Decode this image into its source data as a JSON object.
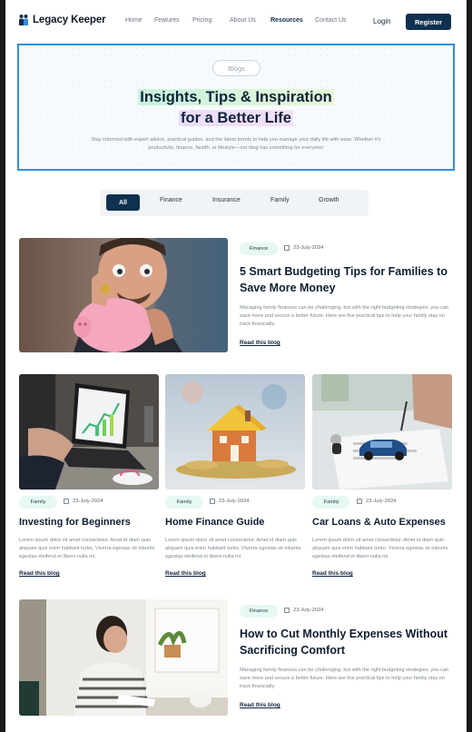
{
  "brand": {
    "name": "Legacy Keeper"
  },
  "nav": {
    "items": [
      "Home",
      "Features",
      "Pricing",
      "About Us",
      "Resources",
      "Contact Us"
    ],
    "active": "Resources",
    "login": "Login",
    "register": "Register"
  },
  "hero": {
    "pill": "Blogs",
    "title_line1": "Insights, Tips & Inspiration",
    "title_line2": "for a Better Life",
    "subtitle": "Stay informed with expert advice, practical guides, and the latest trends to help you manage your daily life with ease. Whether it's productivity, finance, health, or lifestyle—our blog has something for everyone!"
  },
  "filters": {
    "tabs": [
      "All",
      "Finance",
      "Insurance",
      "Family",
      "Growth"
    ],
    "active": "All"
  },
  "posts": [
    {
      "category": "Finance",
      "date": "23-July-2024",
      "title": "5 Smart Budgeting Tips for Families to Save More Money",
      "excerpt": "Managing family finances can be challenging, but with the right budgeting strategies, you can save more and secure a better future. Here are five practical tips to help your family stay on track financially.",
      "read_more": "Read this blog",
      "image": "piggy-bank-man"
    },
    {
      "category": "Family",
      "date": "23-July-2024",
      "title": "Investing for Beginners",
      "excerpt": "Lorem ipsum dolor sit amet consectetur. Amet id diam quis aliquam quis enim habitant tortor. Viverra egestas sit lobortis egestas eleifend et libero nulla mi.",
      "read_more": "Read this blog",
      "image": "laptop-charts"
    },
    {
      "category": "Family",
      "date": "23-July-2024",
      "title": "Home Finance Guide",
      "excerpt": "Lorem ipsum dolor sit amet consectetur. Amet id diam quis aliquam quis enim habitant tortor. Viverra egestas sit lobortis egestas eleifend et libero nulla mi.",
      "read_more": "Read this blog",
      "image": "house-on-coins"
    },
    {
      "category": "Family",
      "date": "23-July-2024",
      "title": "Car Loans & Auto Expenses",
      "excerpt": "Lorem ipsum dolor sit amet consectetur. Amet id diam quis aliquam quis enim habitant tortor. Viverra egestas sit lobortis egestas eleifend et libero nulla mi.",
      "read_more": "Read this blog",
      "image": "car-keys-signing"
    },
    {
      "category": "Finance",
      "date": "23-July-2024",
      "title": "How to Cut Monthly Expenses Without Sacrificing Comfort",
      "excerpt": "Managing family finances can be challenging, but with the right budgeting strategies, you can save more and secure a better future. Here are five practical tips to help your family stay on track financially.",
      "read_more": "Read this blog",
      "image": "woman-reading"
    }
  ]
}
